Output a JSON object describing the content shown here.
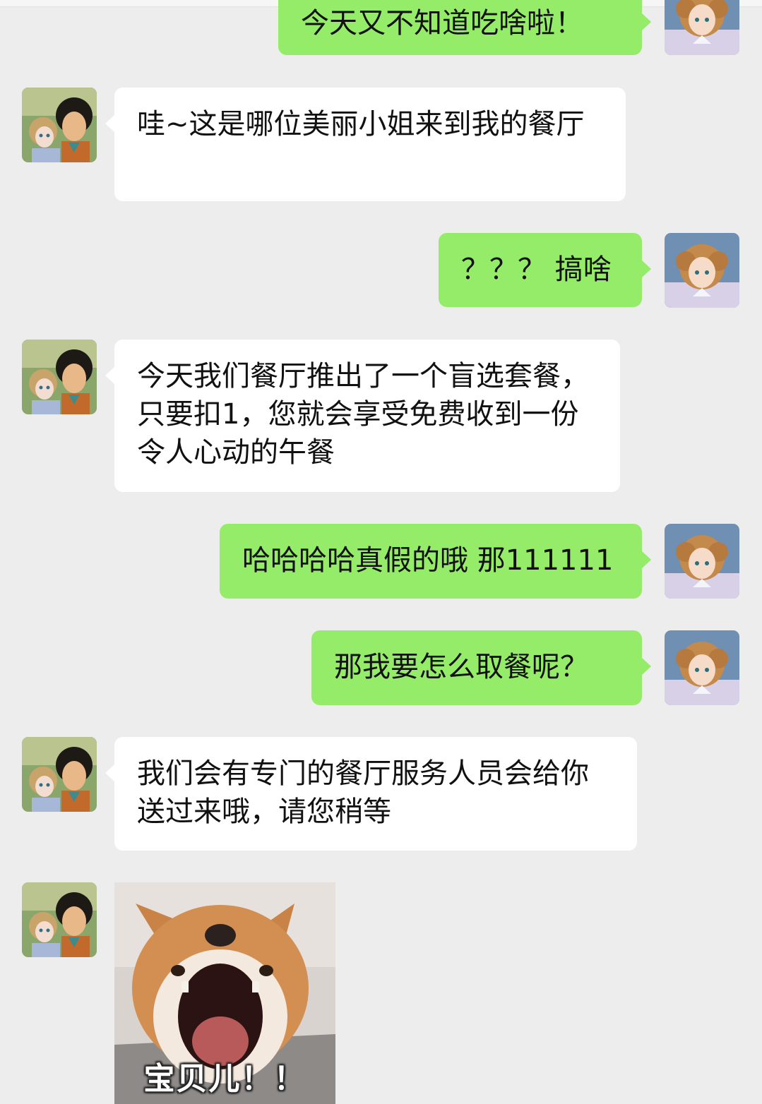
{
  "messages": [
    {
      "sender": "me",
      "text": "今天又不知道吃啥啦！"
    },
    {
      "sender": "them",
      "text": "哇~这是哪位美丽小姐来到我的餐厅"
    },
    {
      "sender": "me",
      "text": "？？？ 搞啥"
    },
    {
      "sender": "them",
      "text": "今天我们餐厅推出了一个盲选套餐，只要扣1，您就会享受免费收到一份令人心动的午餐"
    },
    {
      "sender": "me",
      "text": "哈哈哈哈真假的哦 那111111"
    },
    {
      "sender": "me",
      "text": "那我要怎么取餐呢？"
    },
    {
      "sender": "them",
      "text": "我们会有专门的餐厅服务人员会给你送过来哦，请您稍等"
    },
    {
      "sender": "them",
      "type": "sticker",
      "text": "宝贝儿！！"
    }
  ],
  "avatars": {
    "me": "girl-avatar-icon",
    "them": "couple-avatar-icon"
  },
  "colors": {
    "background": "#ededed",
    "outgoing_bubble": "#95ec69",
    "incoming_bubble": "#ffffff"
  }
}
